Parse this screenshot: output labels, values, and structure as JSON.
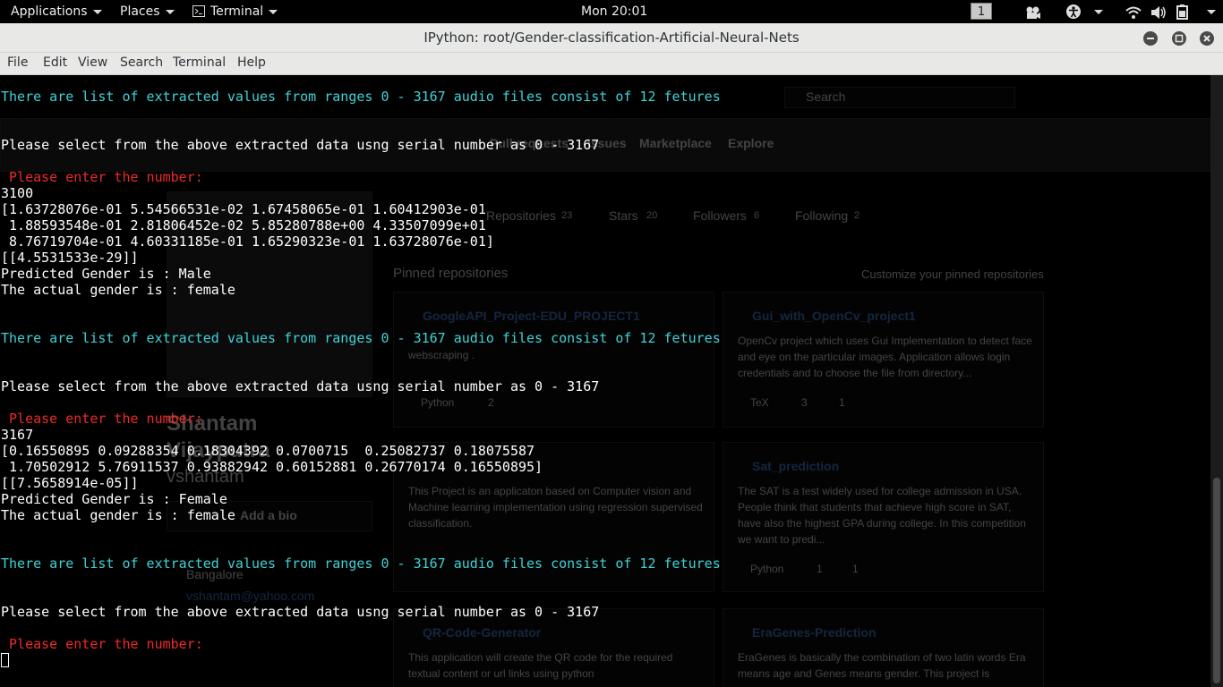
{
  "top_panel": {
    "applications": "Applications",
    "places": "Places",
    "terminal": "Terminal",
    "clock": "Mon 20:01",
    "workspace": "1"
  },
  "window": {
    "title": "IPython: root/Gender-classification-Artificial-Neural-Nets"
  },
  "menu": [
    "File",
    "Edit",
    "View",
    "Search",
    "Terminal",
    "Help"
  ],
  "terminal_lines": [
    {
      "text": "There are list of extracted values from ranges 0 - 3167 audio files consist of 12 fetures",
      "color": "cyan"
    },
    {
      "text": "",
      "color": "white"
    },
    {
      "text": "",
      "color": "white"
    },
    {
      "text": "Please select from the above extracted data usng serial number as 0 - 3167",
      "color": "white"
    },
    {
      "text": "",
      "color": "white"
    },
    {
      "text": " Please enter the number:",
      "color": "red"
    },
    {
      "text": "3100",
      "color": "white"
    },
    {
      "text": "[1.63728076e-01 5.54566531e-02 1.67458065e-01 1.60412903e-01",
      "color": "white"
    },
    {
      "text": " 1.88593548e-01 2.81806452e-02 5.85280788e+00 4.33507099e+01",
      "color": "white"
    },
    {
      "text": " 8.76719704e-01 4.60331185e-01 1.65290323e-01 1.63728076e-01]",
      "color": "white"
    },
    {
      "text": "[[4.5531533e-29]]",
      "color": "white"
    },
    {
      "text": "Predicted Gender is : Male",
      "color": "white"
    },
    {
      "text": "The actual gender is : female",
      "color": "white"
    },
    {
      "text": "",
      "color": "white"
    },
    {
      "text": "",
      "color": "white"
    },
    {
      "text": "There are list of extracted values from ranges 0 - 3167 audio files consist of 12 fetures",
      "color": "cyan"
    },
    {
      "text": "",
      "color": "white"
    },
    {
      "text": "",
      "color": "white"
    },
    {
      "text": "Please select from the above extracted data usng serial number as 0 - 3167",
      "color": "white"
    },
    {
      "text": "",
      "color": "white"
    },
    {
      "text": " Please enter the number:",
      "color": "red"
    },
    {
      "text": "3167",
      "color": "white"
    },
    {
      "text": "[0.16550895 0.09288354 0.18304392 0.0700715  0.25082737 0.18075587",
      "color": "white"
    },
    {
      "text": " 1.70502912 5.76911537 0.93882942 0.60152881 0.26770174 0.16550895]",
      "color": "white"
    },
    {
      "text": "[[7.5658914e-05]]",
      "color": "white"
    },
    {
      "text": "Predicted Gender is : Female",
      "color": "white"
    },
    {
      "text": "The actual gender is : female",
      "color": "white"
    },
    {
      "text": "",
      "color": "white"
    },
    {
      "text": "",
      "color": "white"
    },
    {
      "text": "There are list of extracted values from ranges 0 - 3167 audio files consist of 12 fetures",
      "color": "cyan"
    },
    {
      "text": "",
      "color": "white"
    },
    {
      "text": "",
      "color": "white"
    },
    {
      "text": "Please select from the above extracted data usng serial number as 0 - 3167",
      "color": "white"
    },
    {
      "text": "",
      "color": "white"
    },
    {
      "text": " Please enter the number:",
      "color": "red"
    }
  ],
  "ghost": {
    "search_placeholder": "Search",
    "nav": [
      "Pull requests",
      "Issues",
      "Marketplace",
      "Explore"
    ],
    "tabs": [
      {
        "label": "Repositories",
        "count": "23"
      },
      {
        "label": "Stars",
        "count": "20"
      },
      {
        "label": "Followers",
        "count": "6"
      },
      {
        "label": "Following",
        "count": "2"
      }
    ],
    "pinned_title": "Pinned repositories",
    "customize": "Customize your pinned repositories",
    "name": "Shantam",
    "name2": "Vijayputra",
    "username": "vshantam",
    "add_bio": "Add a bio",
    "location": "Bangalore",
    "email": "vshantam@yahoo.com",
    "repos": [
      {
        "name": "GoogleAPI_Project-EDU_PROJECT1",
        "desc": "webscraping .",
        "lang": "Python",
        "stars": "2",
        "forks": ""
      },
      {
        "name": "Gui_with_OpenCv_project1",
        "desc": "OpenCv project which uses Gui Implementation to detect face and eye on the particular images. Application allows login credentials and to choose the file from directory...",
        "lang": "TeX",
        "stars": "3",
        "forks": "1"
      },
      {
        "name": "",
        "desc": "This Project is an applicaton based on Computer vision and Machine learning implementation using regression supervised classification.",
        "lang": "",
        "stars": "",
        "forks": ""
      },
      {
        "name": "Sat_prediction",
        "desc": "The SAT is a test widely used for college admission in USA. People think that students that achieve high score in SAT, have also the highest GPA during college. In this competition we want to predi...",
        "lang": "Python",
        "stars": "1",
        "forks": "1"
      },
      {
        "name": "QR-Code-Generator",
        "desc": "This application will create the QR code for the required textual content or url links using python",
        "lang": "",
        "stars": "",
        "forks": ""
      },
      {
        "name": "EraGenes-Prediction",
        "desc": "EraGenes is basically the combination of two latin words Era means age and Genes means gender. This project is",
        "lang": "",
        "stars": "",
        "forks": ""
      }
    ]
  },
  "colors": {
    "cyan": "#3ed3d8",
    "red": "#ef2929",
    "white": "#ffffff",
    "link": "#4078c0"
  }
}
